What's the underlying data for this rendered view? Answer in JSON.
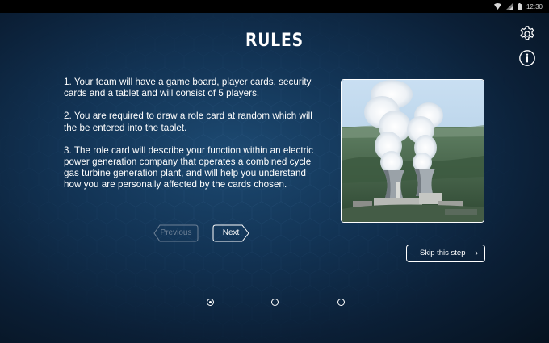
{
  "status_bar": {
    "time": "12:30",
    "icons": [
      "wifi-icon",
      "signal-icon",
      "battery-icon"
    ]
  },
  "header": {
    "title": "RULES",
    "icons": [
      "gear-icon",
      "info-icon"
    ]
  },
  "rules": [
    "1. Your team will have a game board, player cards, security cards and a tablet and will consist of 5 players.",
    "2. You are required to draw a role card at random which will the be entered into the tablet.",
    "3. The role card will describe your function within an electric power generation company that operates a combined cycle gas turbine generation plant, and will help you understand how you are personally affected by the cards chosen."
  ],
  "image": {
    "subject": "power-plant-cooling-towers"
  },
  "navigation": {
    "previous_label": "Previous",
    "previous_enabled": false,
    "next_label": "Next",
    "skip_label": "Skip this step",
    "skip_icon": "chevron-right-icon"
  },
  "pager": {
    "pages": 3,
    "current": 1
  },
  "colors": {
    "background": "#0f2b47",
    "accent": "#ffffff",
    "disabled": "#6e8196"
  }
}
